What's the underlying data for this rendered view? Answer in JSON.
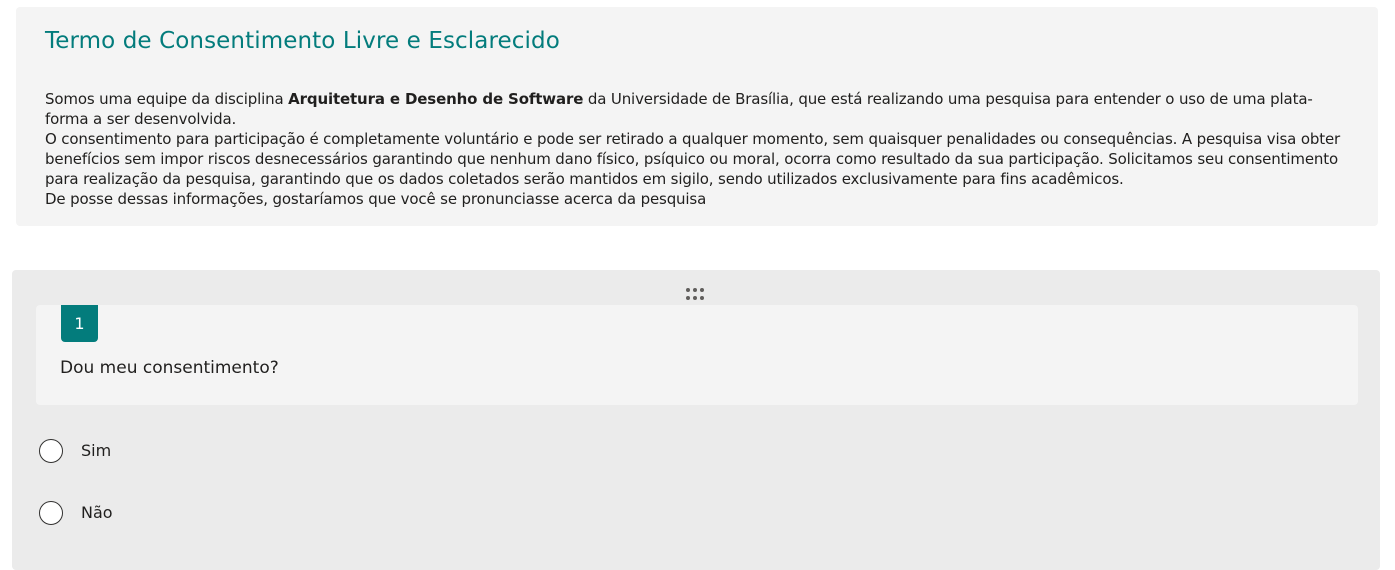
{
  "intro": {
    "title": "Termo de Consentimento Livre e Esclarecido",
    "p1_pre": "Somos uma equipe da disciplina ",
    "p1_bold": "Arquitetura e Desenho de Software",
    "p1_post": " da Universidade de Brasília, que está realizando uma pesquisa para entender o uso de uma plata-forma a ser desenvolvida.",
    "p2": "O consentimento para participação é completamente voluntário e pode ser retirado a qualquer momento, sem quaisquer penalidades ou consequências. A pesquisa visa obter benefícios sem impor riscos desnecessários garantindo que nenhum dano físico, psíquico ou moral, ocorra como resultado da sua participação. Solicitamos seu consentimento para realização da pesquisa, garantindo que os dados coletados serão mantidos em sigilo, sendo utilizados exclusivamente para fins acadêmicos.",
    "p3": "De posse dessas informações, gostaríamos que você se pronunciasse acerca da pesquisa"
  },
  "question": {
    "number": "1",
    "text": "Dou meu consentimento?",
    "options": [
      {
        "label": "Sim"
      },
      {
        "label": "Não"
      }
    ]
  },
  "colors": {
    "accent": "#037c7c",
    "panel": "#f4f4f4",
    "question_bg": "#ebebeb"
  },
  "icons": {
    "drag": "drag-handle-icon",
    "radio": "radio-button-icon"
  }
}
